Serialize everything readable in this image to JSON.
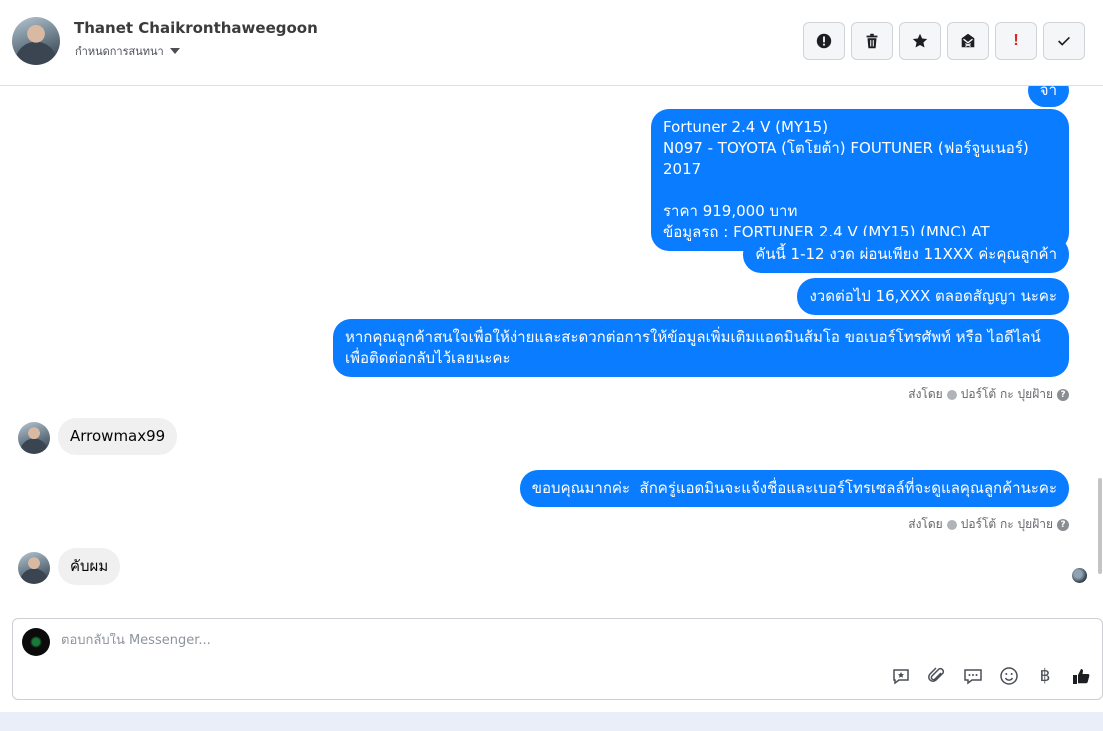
{
  "header": {
    "name": "Thanet Chaikronthaweegoon",
    "assign_label": "กำหนดการสนทนา",
    "toolbar": [
      {
        "name": "report-spam-button",
        "icon": "alert-circle-icon"
      },
      {
        "name": "delete-button",
        "icon": "trash-icon"
      },
      {
        "name": "star-button",
        "icon": "star-icon"
      },
      {
        "name": "mark-unread-button",
        "icon": "envelope-x-icon"
      },
      {
        "name": "follow-up-button",
        "icon": "exclamation-icon",
        "text": "!"
      },
      {
        "name": "mark-done-button",
        "icon": "check-icon"
      }
    ]
  },
  "messages": {
    "partial_top": "จ้า",
    "car_info": "Fortuner 2.4 V (MY15)\nN097 - TOYOTA (โตโยต้า) FOUTUNER (ฟอร์จูนเนอร์) 2017\n\nราคา 919,000 บาท\nข้อมูลรถ : FORTUNER 2.4 V (MY15) (MNC) AT",
    "installment_1": "คันนี้ 1-12 งวด ผ่อนเพียง 11XXX ค่ะคุณลูกค้า",
    "installment_2": "งวดต่อไป 16,XXX ตลอดสัญญา นะคะ",
    "contact_request": "หากคุณลูกค้าสนใจเพื่อให้ง่ายและสะดวกต่อการให้ข้อมูลเพิ่มเติมแอดมินส้มโอ ขอเบอร์โทรศัพท์ หรือ ไอดีไลน์\nเพื่อติดต่อกลับไว้เลยนะคะ",
    "sent_by_1": "ส่งโดย",
    "sender_1": "ปอร์โต้ กะ ปุยฝ้าย",
    "incoming_1": "Arrowmax99",
    "thanks": "ขอบคุณมากค่ะ  สักครู่แอดมินจะแจ้งชื่อและเบอร์โทรเซลล์ที่จะดูแลคุณลูกค้านะคะ",
    "sent_by_2": "ส่งโดย",
    "sender_2": "ปอร์โต้ กะ ปุยฝ้าย",
    "incoming_2": "คับผม"
  },
  "composer": {
    "placeholder": "ตอบกลับใน Messenger...",
    "baht_symbol": "฿",
    "icons": [
      "saved-reply-icon",
      "paperclip-icon",
      "chat-bubbles-icon",
      "emoji-icon",
      "baht-icon",
      "thumbs-up-icon"
    ]
  },
  "colors": {
    "outgoing_bubble": "#0a7cff",
    "incoming_bubble": "#f0f0f0"
  }
}
